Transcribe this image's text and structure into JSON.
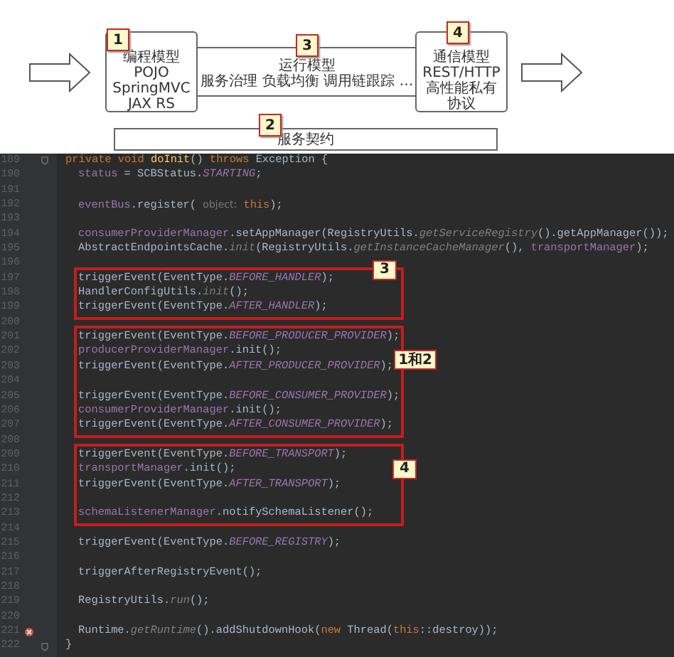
{
  "diagram": {
    "left_box": {
      "badge": "1",
      "lines": [
        "编程模型",
        "POJO",
        "SpringMVC",
        "JAX RS"
      ]
    },
    "middle_band": {
      "badge": "3",
      "lines": [
        "运行模型",
        "服务治理 负载均衡 调用链跟踪 …"
      ]
    },
    "right_box": {
      "badge": "4",
      "lines": [
        "通信模型",
        "REST/HTTP",
        "高性能私有",
        "协议"
      ]
    },
    "bottom_bar": {
      "badge": "2",
      "lines": [
        "服务契约"
      ]
    }
  },
  "code": {
    "signature": {
      "number": "189",
      "fold": true,
      "tokens": [
        {
          "text": "private void ",
          "kind": "kw"
        },
        {
          "text": "doInit",
          "kind": "method"
        },
        {
          "text": "() ",
          "kind": "plain"
        },
        {
          "text": "throws ",
          "kind": "kw"
        },
        {
          "text": "Exception {",
          "kind": "plain"
        }
      ]
    },
    "body": [
      {
        "lines": [
          {
            "number": "190",
            "tokens": [
              {
                "text": "status",
                "kind": "field"
              },
              {
                "text": " = SCBStatus.",
                "kind": "plain"
              },
              {
                "text": "STARTING",
                "kind": "static"
              },
              {
                "text": ";",
                "kind": "plain"
              }
            ]
          },
          {
            "number": "191"
          },
          {
            "number": "192",
            "tokens": [
              {
                "text": "eventBus",
                "kind": "field"
              },
              {
                "text": ".register( ",
                "kind": "plain"
              },
              {
                "text": "object:",
                "kind": "hint"
              },
              {
                "text": " this",
                "kind": "kw"
              },
              {
                "text": ");",
                "kind": "plain"
              }
            ]
          },
          {
            "number": "193"
          },
          {
            "number": "194",
            "tokens": [
              {
                "text": "consumerProviderManager",
                "kind": "field"
              },
              {
                "text": ".setAppManager(RegistryUtils.",
                "kind": "plain"
              },
              {
                "text": "getServiceRegistry",
                "kind": "italic"
              },
              {
                "text": "().getAppManager());",
                "kind": "plain"
              }
            ]
          },
          {
            "number": "195",
            "tokens": [
              {
                "text": "AbstractEndpointsCache.",
                "kind": "plain"
              },
              {
                "text": "init",
                "kind": "italic"
              },
              {
                "text": "(RegistryUtils.",
                "kind": "plain"
              },
              {
                "text": "getInstanceCacheManager",
                "kind": "italic"
              },
              {
                "text": "(), ",
                "kind": "plain"
              },
              {
                "text": "transportManager",
                "kind": "field"
              },
              {
                "text": ");",
                "kind": "plain"
              }
            ]
          },
          {
            "number": "196"
          }
        ]
      },
      {
        "callout": "3",
        "lines": [
          {
            "number": "197",
            "tokens": [
              {
                "text": "triggerEvent(EventType.",
                "kind": "plain"
              },
              {
                "text": "BEFORE_HANDLER",
                "kind": "static"
              },
              {
                "text": ");",
                "kind": "plain"
              }
            ]
          },
          {
            "number": "198",
            "tokens": [
              {
                "text": "HandlerConfigUtils.",
                "kind": "plain"
              },
              {
                "text": "init",
                "kind": "italic"
              },
              {
                "text": "();",
                "kind": "plain"
              }
            ]
          },
          {
            "number": "199",
            "tokens": [
              {
                "text": "triggerEvent(EventType.",
                "kind": "plain"
              },
              {
                "text": "AFTER_HANDLER",
                "kind": "static"
              },
              {
                "text": ");",
                "kind": "plain"
              }
            ]
          }
        ]
      },
      {
        "lines": [
          {
            "number": "200"
          }
        ]
      },
      {
        "callout": "1和2",
        "lines": [
          {
            "number": "201",
            "tokens": [
              {
                "text": "triggerEvent(EventType.",
                "kind": "plain"
              },
              {
                "text": "BEFORE_PRODUCER_PROVIDER",
                "kind": "static"
              },
              {
                "text": ");",
                "kind": "plain"
              }
            ]
          },
          {
            "number": "202",
            "tokens": [
              {
                "text": "producerProviderManager",
                "kind": "field"
              },
              {
                "text": ".init();",
                "kind": "plain"
              }
            ]
          },
          {
            "number": "203",
            "tokens": [
              {
                "text": "triggerEvent(EventType.",
                "kind": "plain"
              },
              {
                "text": "AFTER_PRODUCER_PROVIDER",
                "kind": "static"
              },
              {
                "text": ");",
                "kind": "plain"
              }
            ]
          },
          {
            "number": "204"
          },
          {
            "number": "205",
            "tokens": [
              {
                "text": "triggerEvent(EventType.",
                "kind": "plain"
              },
              {
                "text": "BEFORE_CONSUMER_PROVIDER",
                "kind": "static"
              },
              {
                "text": ");",
                "kind": "plain"
              }
            ]
          },
          {
            "number": "206",
            "tokens": [
              {
                "text": "consumerProviderManager",
                "kind": "field"
              },
              {
                "text": ".init();",
                "kind": "plain"
              }
            ]
          },
          {
            "number": "207",
            "tokens": [
              {
                "text": "triggerEvent(EventType.",
                "kind": "plain"
              },
              {
                "text": "AFTER_CONSUMER_PROVIDER",
                "kind": "static"
              },
              {
                "text": ");",
                "kind": "plain"
              }
            ]
          }
        ]
      },
      {
        "lines": [
          {
            "number": "208"
          }
        ]
      },
      {
        "callout": "4",
        "lines": [
          {
            "number": "209",
            "tokens": [
              {
                "text": "triggerEvent(EventType.",
                "kind": "plain"
              },
              {
                "text": "BEFORE_TRANSPORT",
                "kind": "static"
              },
              {
                "text": ");",
                "kind": "plain"
              }
            ]
          },
          {
            "number": "210",
            "tokens": [
              {
                "text": "transportManager",
                "kind": "field"
              },
              {
                "text": ".init();",
                "kind": "plain"
              }
            ]
          },
          {
            "number": "211",
            "tokens": [
              {
                "text": "triggerEvent(EventType.",
                "kind": "plain"
              },
              {
                "text": "AFTER_TRANSPORT",
                "kind": "static"
              },
              {
                "text": ");",
                "kind": "plain"
              }
            ]
          },
          {
            "number": "212"
          },
          {
            "number": "213",
            "tokens": [
              {
                "text": "schemaListenerManager",
                "kind": "field"
              },
              {
                "text": ".notifySchemaListener();",
                "kind": "plain"
              }
            ]
          }
        ]
      },
      {
        "lines": [
          {
            "number": "214"
          },
          {
            "number": "215",
            "tokens": [
              {
                "text": "triggerEvent(EventType.",
                "kind": "plain"
              },
              {
                "text": "BEFORE_REGISTRY",
                "kind": "static"
              },
              {
                "text": ");",
                "kind": "plain"
              }
            ]
          },
          {
            "number": "216"
          },
          {
            "number": "217",
            "tokens": [
              {
                "text": "triggerAfterRegistryEvent();",
                "kind": "plain"
              }
            ]
          },
          {
            "number": "218"
          },
          {
            "number": "219",
            "tokens": [
              {
                "text": "RegistryUtils.",
                "kind": "plain"
              },
              {
                "text": "run",
                "kind": "italic"
              },
              {
                "text": "();",
                "kind": "plain"
              }
            ]
          },
          {
            "number": "220"
          },
          {
            "number": "221",
            "breakpoint": true,
            "tokens": [
              {
                "text": "Runtime.",
                "kind": "plain"
              },
              {
                "text": "getRuntime",
                "kind": "italic"
              },
              {
                "text": "().addShutdownHook(",
                "kind": "plain"
              },
              {
                "text": "new ",
                "kind": "kw"
              },
              {
                "text": "Thread(",
                "kind": "plain"
              },
              {
                "text": "this",
                "kind": "kw"
              },
              {
                "text": "::destroy));",
                "kind": "plain"
              }
            ]
          }
        ]
      }
    ],
    "closing": {
      "number": "222",
      "fold": true,
      "tokens": [
        {
          "text": "}",
          "kind": "plain"
        }
      ]
    }
  }
}
